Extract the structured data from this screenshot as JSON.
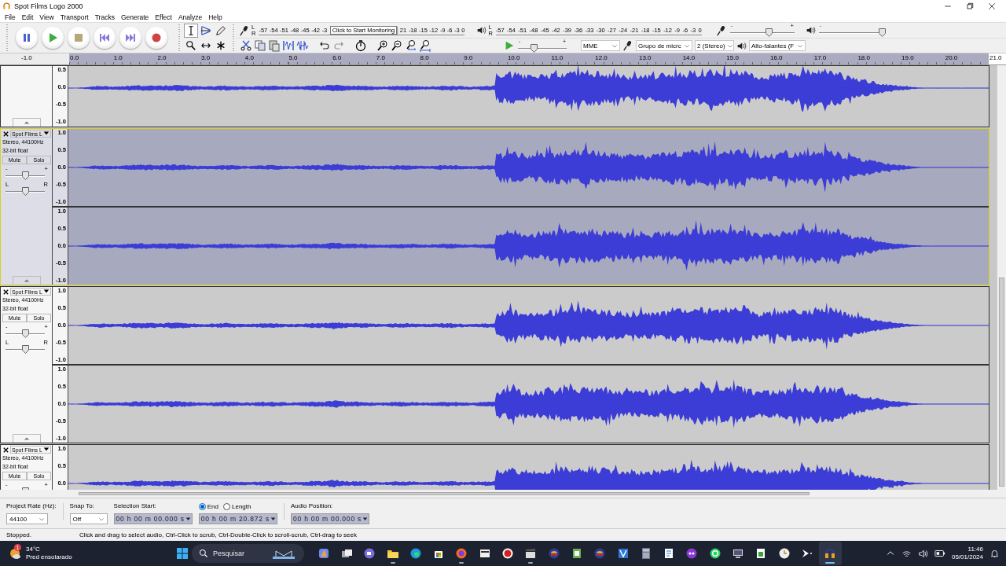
{
  "window": {
    "title": "Spot Films Logo 2000"
  },
  "menu": [
    "File",
    "Edit",
    "View",
    "Transport",
    "Tracks",
    "Generate",
    "Effect",
    "Analyze",
    "Help"
  ],
  "tools": [
    {
      "selected": true
    },
    {
      "selected": false
    },
    {
      "selected": false
    },
    {
      "selected": false
    },
    {
      "selected": false
    },
    {
      "selected": false
    }
  ],
  "record_meter": {
    "channels": [
      "L",
      "R"
    ],
    "ticks_before": [
      "-57",
      "-54",
      "-51",
      "-48",
      "-45",
      "-42",
      "-3"
    ],
    "tooltip": "Click to Start Monitoring",
    "ticks_after": [
      "21",
      "-18",
      "-15",
      "-12",
      "-9",
      "-6",
      "-3",
      "0"
    ]
  },
  "play_meter": {
    "channels": [
      "L",
      "R"
    ],
    "ticks": [
      "-57",
      "-54",
      "-51",
      "-48",
      "-45",
      "-42",
      "-39",
      "-36",
      "-33",
      "-30",
      "-27",
      "-24",
      "-21",
      "-18",
      "-15",
      "-12",
      "-9",
      "-6",
      "-3",
      "0"
    ]
  },
  "mixer": {
    "record_volume": {
      "min": "-",
      "max": "+",
      "level": 0.6
    },
    "play_volume": {
      "min": "-",
      "level": 0.98
    }
  },
  "play_at_speed": {
    "min": "-",
    "max": "+",
    "level": 0.33
  },
  "device": {
    "host": "MME",
    "recording_device": "Grupo de micrc",
    "channels": "2 (Stereo)",
    "playback_device": "Alto-falantes (F"
  },
  "ruler": {
    "labels": [
      "-1.0",
      "0.0",
      "1.0",
      "2.0",
      "3.0",
      "4.0",
      "5.0",
      "6.0",
      "7.0",
      "8.0",
      "9.0",
      "10.0",
      "11.0",
      "12.0",
      "13.0",
      "14.0",
      "15.0",
      "16.0",
      "17.0",
      "18.0",
      "19.0",
      "20.0",
      "21.0"
    ]
  },
  "tracks": [
    {
      "selected": false,
      "collapse_button": true,
      "channels": [
        {
          "kind": "lower_part",
          "scale": [
            "0.5",
            "0.0",
            "-0.5",
            "-1.0"
          ]
        }
      ]
    },
    {
      "name": "Spot Films L",
      "info": [
        "Stereo, 44100Hz",
        "32-bit float"
      ],
      "buttons": [
        "Mute",
        "Solo"
      ],
      "gain": {
        "min": "-",
        "max": "+",
        "level": 0.5
      },
      "pan": {
        "min": "L",
        "max": "R",
        "level": 0.5
      },
      "selected": true,
      "collapse_button": true,
      "channels": [
        {
          "kind": "full",
          "scale": [
            "1.0",
            "0.5",
            "0.0",
            "-0.5",
            "-1.0"
          ]
        },
        {
          "kind": "full",
          "scale": [
            "1.0",
            "0.5",
            "0.0",
            "-0.5",
            "-1.0"
          ]
        }
      ]
    },
    {
      "name": "Spot Films L",
      "info": [
        "Stereo, 44100Hz",
        "32-bit float"
      ],
      "buttons": [
        "Mute",
        "Solo"
      ],
      "gain": {
        "min": "-",
        "max": "+",
        "level": 0.5
      },
      "pan": {
        "min": "L",
        "max": "R",
        "level": 0.5
      },
      "selected": false,
      "collapse_button": true,
      "channels": [
        {
          "kind": "full",
          "scale": [
            "1.0",
            "0.5",
            "0.0",
            "-0.5",
            "-1.0"
          ]
        },
        {
          "kind": "full",
          "scale": [
            "1.0",
            "0.5",
            "0.0",
            "-0.5",
            "-1.0"
          ]
        }
      ]
    },
    {
      "name": "Spot Films L",
      "info": [
        "Stereo, 44100Hz",
        "32-bit float"
      ],
      "buttons": [
        "Mute",
        "Solo"
      ],
      "gain": {
        "min": "-",
        "max": "+",
        "level": 0.5
      },
      "selected": false,
      "collapse_button": false,
      "channels": [
        {
          "kind": "upper_part",
          "scale": [
            "1.0",
            "0.5",
            "0.0"
          ]
        }
      ]
    }
  ],
  "selection_toolbar": {
    "project_rate": {
      "label": "Project Rate (Hz):",
      "value": "44100"
    },
    "snap_to": {
      "label": "Snap To:",
      "value": "Off"
    },
    "selection_start": {
      "label": "Selection Start:",
      "value": "00 h 00 m 00.000 s"
    },
    "end_length": [
      {
        "label": "End",
        "selected": true
      },
      {
        "label": "Length",
        "selected": false
      }
    ],
    "selection_end": {
      "value": "00 h 00 m 20.872 s"
    },
    "audio_position": {
      "label": "Audio Position:",
      "value": "00 h 00 m 00.000 s"
    }
  },
  "status": {
    "state": "Stopped.",
    "hint": "Click and drag to select audio, Ctrl-Click to scrub, Ctrl-Double-Click to scroll-scrub, Ctrl-drag to seek"
  },
  "taskbar": {
    "weather": {
      "badge": "1",
      "temperature": "34°C",
      "condition": "Pred ensolarado"
    },
    "search": {
      "placeholder": "Pesquisar"
    },
    "apps": [
      {
        "running": false,
        "active": false
      },
      {
        "running": false,
        "active": false
      },
      {
        "running": false,
        "active": false
      },
      {
        "running": true,
        "active": false
      },
      {
        "running": false,
        "active": false
      },
      {
        "running": false,
        "active": false
      },
      {
        "running": true,
        "active": false
      },
      {
        "running": false,
        "active": false
      },
      {
        "running": false,
        "active": false
      },
      {
        "running": true,
        "active": false
      },
      {
        "running": false,
        "active": false
      },
      {
        "running": false,
        "active": false
      },
      {
        "running": false,
        "active": false
      },
      {
        "running": false,
        "active": false
      },
      {
        "running": false,
        "active": false
      },
      {
        "running": false,
        "active": false
      },
      {
        "running": false,
        "active": false
      },
      {
        "running": false,
        "active": false
      },
      {
        "running": false,
        "active": false
      },
      {
        "running": false,
        "active": false
      },
      {
        "running": false,
        "active": false
      },
      {
        "running": false,
        "active": false
      },
      {
        "running": true,
        "active": true
      }
    ],
    "clock": {
      "time": "11:46",
      "date": "05/01/2024"
    }
  }
}
